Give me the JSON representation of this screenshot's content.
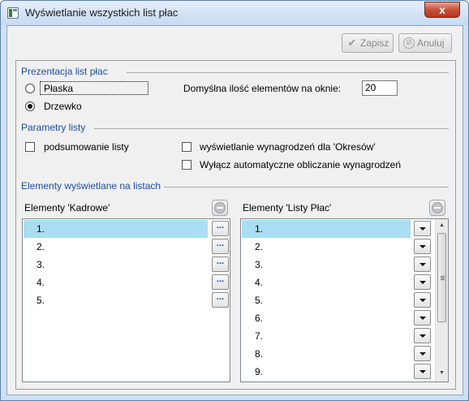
{
  "window": {
    "title": "Wyświetlanie wszystkich list płac",
    "close_label": "x"
  },
  "toolbar": {
    "save_label": "Zapisz",
    "cancel_label": "Anuluj",
    "save_icon": "checkmark-icon",
    "cancel_icon": "cancel-circle-icon"
  },
  "presentation": {
    "title": "Prezentacja list płac",
    "option_flat": "Płaska",
    "option_tree": "Drzewko",
    "selected": "Drzewko",
    "default_count_label": "Domyślna ilość elementów na oknie:",
    "default_count_value": "20"
  },
  "parameters": {
    "title": "Parametry listy",
    "summary_label": "podsumowanie listy",
    "periods_label": "wyświetlanie wynagrodzeń dla 'Okresów'",
    "auto_calc_label": "Wyłącz automatyczne obliczanie wynagrodzeń",
    "summary_checked": false,
    "periods_checked": false,
    "auto_calc_checked": false
  },
  "elements": {
    "title": "Elementy wyświetlane na listach",
    "hr_list": {
      "title": "Elementy 'Kadrowe'",
      "rows": [
        "1.",
        "2.",
        "3.",
        "4.",
        "5."
      ],
      "button_label": "..."
    },
    "payroll_list": {
      "title": "Elementy 'Listy Płac'",
      "rows": [
        "1.",
        "2.",
        "3.",
        "4.",
        "5.",
        "6.",
        "7.",
        "8.",
        "9."
      ]
    }
  },
  "colors": {
    "selection": "#a9def2",
    "section_title": "#1c4fa0"
  }
}
